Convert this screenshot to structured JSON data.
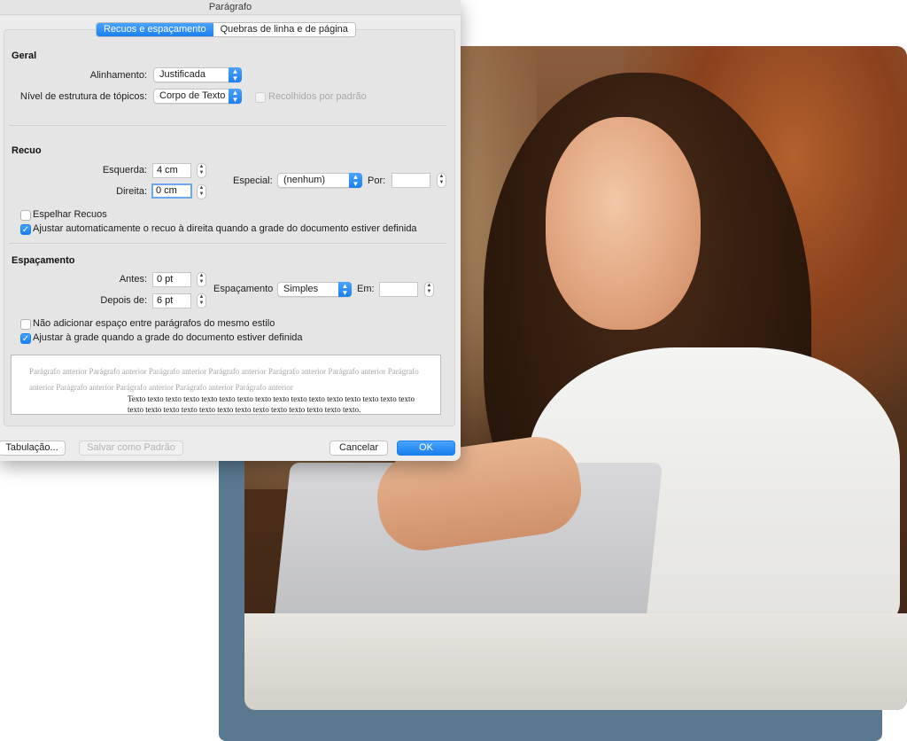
{
  "window": {
    "title": "Parágrafo"
  },
  "tabs": [
    {
      "label": "Recuos e espaçamento",
      "active": true
    },
    {
      "label": "Quebras de linha e de página",
      "active": false
    }
  ],
  "general": {
    "title": "Geral",
    "alignment_label": "Alinhamento:",
    "alignment_value": "Justificada",
    "outline_label": "Nível de estrutura de tópicos:",
    "outline_value": "Corpo de Texto",
    "collapsed_label": "Recolhidos por padrão",
    "collapsed_checked": false
  },
  "indent": {
    "title": "Recuo",
    "left_label": "Esquerda:",
    "left_value": "4 cm",
    "right_label": "Direita:",
    "right_value": "0 cm",
    "special_label": "Especial:",
    "special_value": "(nenhum)",
    "by_label": "Por:",
    "by_value": "",
    "mirror_label": "Espelhar Recuos",
    "mirror_checked": false,
    "auto_adjust_label": "Ajustar automaticamente o recuo à direita quando a grade do documento estiver definida",
    "auto_adjust_checked": true
  },
  "spacing": {
    "title": "Espaçamento",
    "before_label": "Antes:",
    "before_value": "0 pt",
    "after_label": "Depois de:",
    "after_value": "6 pt",
    "line_label": "Espaçamento",
    "line_value": "Simples",
    "at_label": "Em:",
    "at_value": "",
    "no_space_label": "Não adicionar espaço entre parágrafos do mesmo estilo",
    "no_space_checked": false,
    "snap_grid_label": "Ajustar à grade quando a grade do documento estiver definida",
    "snap_grid_checked": true
  },
  "preview": {
    "previous_text": "Parágrafo anterior Parágrafo anterior Parágrafo anterior Parágrafo anterior Parágrafo anterior Parágrafo anterior Parágrafo anterior Parágrafo anterior Parágrafo anterior Parágrafo anterior Parágrafo anterior",
    "sample_text": "Texto texto texto texto texto texto texto texto texto texto texto texto texto texto texto texto texto texto texto texto texto texto texto texto texto texto texto texto texto."
  },
  "buttons": {
    "tabs_label": "Tabulação...",
    "save_default_label": "Salvar como Padrão",
    "cancel_label": "Cancelar",
    "ok_label": "OK"
  },
  "icons": {
    "popup_caret": "up-down-chevron-icon",
    "stepper": "stepper-arrows-icon",
    "checkmark": "checkmark-icon"
  },
  "colors": {
    "accent": "#1a7fef",
    "background_card": "#5a7990"
  }
}
